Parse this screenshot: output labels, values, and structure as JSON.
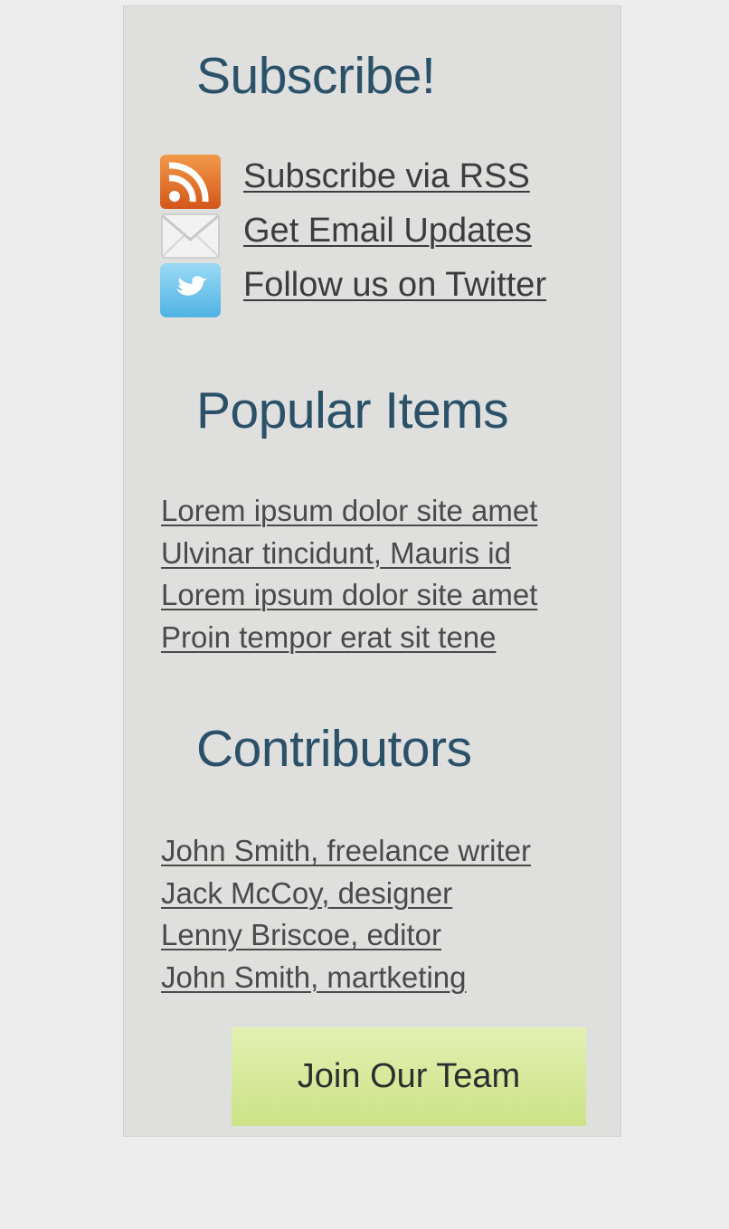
{
  "subscribe": {
    "heading": "Subscribe!",
    "items": [
      {
        "label": "Subscribe via RSS",
        "icon": "rss-icon"
      },
      {
        "label": "Get Email Updates",
        "icon": "envelope-icon"
      },
      {
        "label": "Follow us on Twitter",
        "icon": "twitter-bird-icon"
      }
    ]
  },
  "popular": {
    "heading": "Popular Items",
    "items": [
      "Lorem ipsum dolor site amet",
      "Ulvinar tincidunt, Mauris id",
      "Lorem ipsum dolor site amet",
      "Proin tempor erat sit tene"
    ]
  },
  "contributors": {
    "heading": "Contributors",
    "items": [
      "John Smith, freelance writer",
      "Jack McCoy, designer",
      "Lenny Briscoe, editor",
      "John Smith, martketing"
    ]
  },
  "join_button": {
    "label": "Join Our Team"
  },
  "colors": {
    "heading": "#2b5169",
    "link": "#3c3c3c",
    "panel": "#dfdfde",
    "page": "#eeeded",
    "button_top": "#e2f0b2",
    "button_bottom": "#cde287"
  }
}
